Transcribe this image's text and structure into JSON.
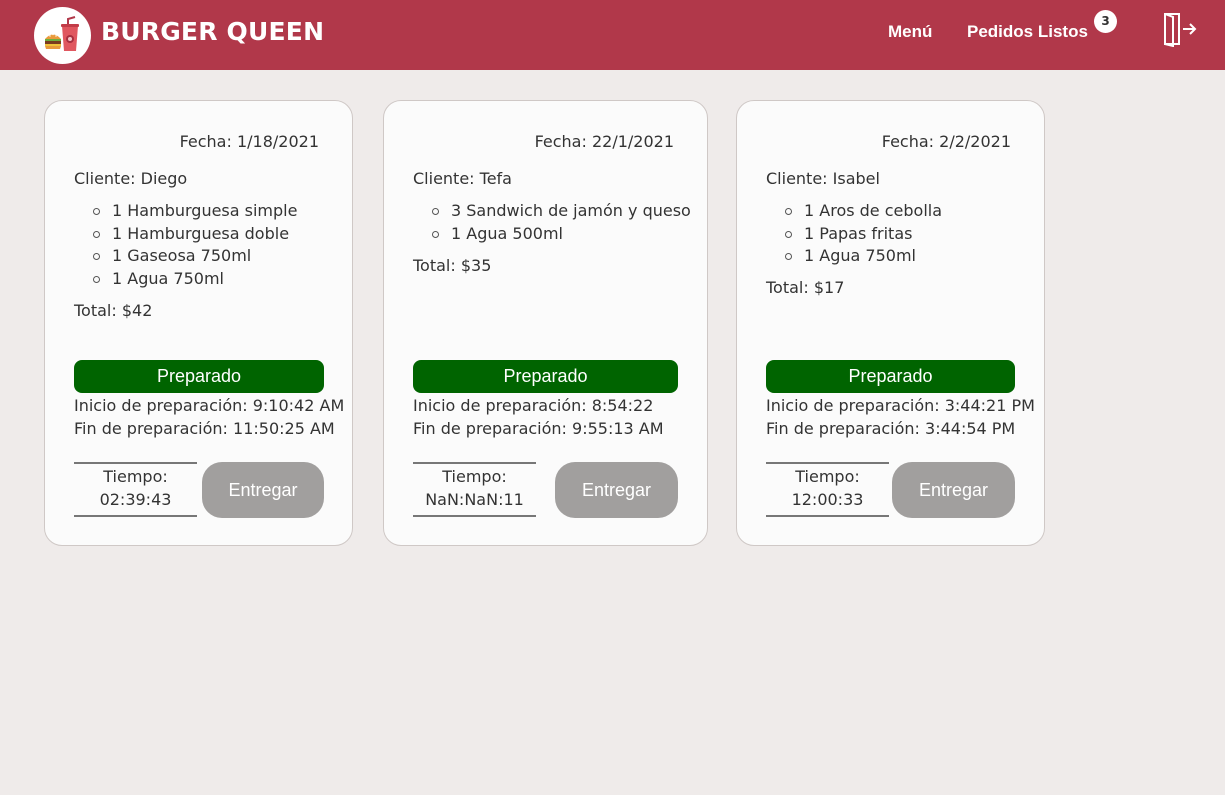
{
  "header": {
    "brand": "BURGER QUEEN",
    "nav": {
      "menu": "Menú",
      "ready_orders": "Pedidos Listos",
      "ready_count": "3"
    },
    "icons": {
      "logo": "burger-drink-logo-icon",
      "logout": "logout-door-icon"
    },
    "colors": {
      "header_bg": "#b1384a",
      "status_bg": "#006400",
      "deliver_bg": "#a19f9e"
    }
  },
  "orders": [
    {
      "date": "Fecha: 1/18/2021",
      "client": "Cliente: Diego",
      "items": [
        "1 Hamburguesa simple",
        "1 Hamburguesa doble",
        "1 Gaseosa 750ml",
        "1 Agua 750ml"
      ],
      "total": "Total: $42",
      "status": "Preparado",
      "prep_start": "Inicio de preparación: 9:10:42 AM",
      "prep_end": "Fin de preparación: 11:50:25 AM",
      "time_label": "Tiempo:",
      "time_value": "02:39:43",
      "deliver_label": "Entregar"
    },
    {
      "date": "Fecha: 22/1/2021",
      "client": "Cliente: Tefa",
      "items": [
        "3 Sandwich de jamón y queso",
        "1 Agua 500ml"
      ],
      "total": "Total: $35",
      "status": "Preparado",
      "prep_start": "Inicio de preparación: 8:54:22",
      "prep_end": "Fin de preparación: 9:55:13 AM",
      "time_label": "Tiempo:",
      "time_value": "NaN:NaN:11",
      "deliver_label": "Entregar"
    },
    {
      "date": "Fecha: 2/2/2021",
      "client": "Cliente: Isabel",
      "items": [
        "1 Aros de cebolla",
        "1 Papas fritas",
        "1 Agua 750ml"
      ],
      "total": "Total: $17",
      "status": "Preparado",
      "prep_start": "Inicio de preparación: 3:44:21 PM",
      "prep_end": "Fin de preparación: 3:44:54 PM",
      "time_label": "Tiempo:",
      "time_value": "12:00:33",
      "deliver_label": "Entregar"
    }
  ]
}
